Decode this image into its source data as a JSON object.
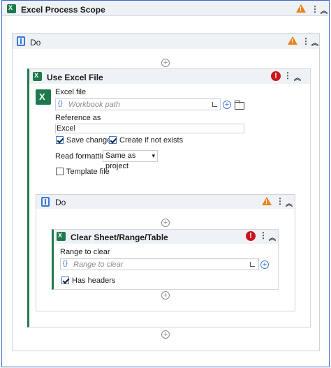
{
  "outer": {
    "title": "Excel Process Scope"
  },
  "do_outer": {
    "title": "Do"
  },
  "use_excel": {
    "title": "Use Excel File",
    "excel_file_label": "Excel file",
    "workbook_placeholder": "Workbook path",
    "reference_as_label": "Reference as",
    "reference_value": "Excel",
    "save_changes_label": "Save changes",
    "create_if_not_exists_label": "Create if not exists",
    "read_formatting_label": "Read formatting",
    "read_formatting_value": "Same as project",
    "template_file_label": "Template file",
    "save_changes_checked": true,
    "create_if_not_exists_checked": true,
    "template_file_checked": false
  },
  "do_inner": {
    "title": "Do"
  },
  "clear_sheet": {
    "title": "Clear Sheet/Range/Table",
    "range_label": "Range to clear",
    "range_placeholder": "Range to clear",
    "has_headers_label": "Has headers",
    "has_headers_checked": true
  },
  "glyphs": {
    "braces": "{}",
    "menu": "⋮",
    "collapse": "︽",
    "plus": "+",
    "error": "!"
  },
  "colors": {
    "accent_blue": "#3a78d8",
    "excel_green": "#1e7a4c",
    "warning": "#e8821c",
    "error": "#c8161d"
  }
}
